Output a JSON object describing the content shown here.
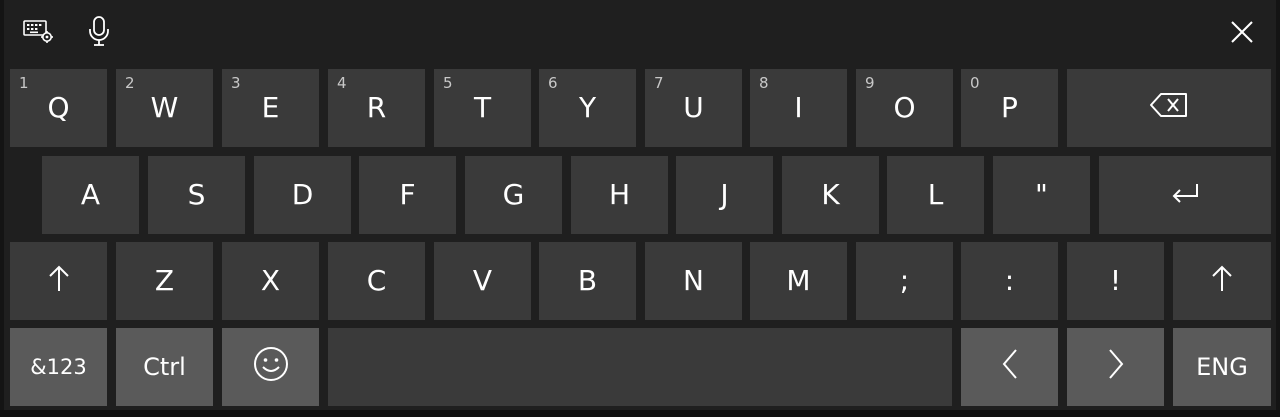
{
  "toolbar": {
    "settings_icon": "keyboard-settings-icon",
    "mic_icon": "microphone-icon",
    "close_icon": "close-icon"
  },
  "row1": [
    {
      "num": "1",
      "label": "Q"
    },
    {
      "num": "2",
      "label": "W"
    },
    {
      "num": "3",
      "label": "E"
    },
    {
      "num": "4",
      "label": "R"
    },
    {
      "num": "5",
      "label": "T"
    },
    {
      "num": "6",
      "label": "Y"
    },
    {
      "num": "7",
      "label": "U"
    },
    {
      "num": "8",
      "label": "I"
    },
    {
      "num": "9",
      "label": "O"
    },
    {
      "num": "0",
      "label": "P"
    }
  ],
  "row2": [
    "A",
    "S",
    "D",
    "F",
    "G",
    "H",
    "J",
    "K",
    "L",
    "\""
  ],
  "row3": [
    "Z",
    "X",
    "C",
    "V",
    "B",
    "N",
    "M",
    ";",
    ":",
    "!"
  ],
  "keys": {
    "backspace_icon": "backspace-icon",
    "enter_icon": "enter-icon",
    "shift_icon": "shift-arrow-icon",
    "symbols_label": "&123",
    "ctrl_label": "Ctrl",
    "emoji_icon": "emoji-smiley-icon",
    "left_label": "<",
    "right_label": ">",
    "lang_label": "ENG"
  },
  "colors": {
    "key": "#3a3a3a",
    "function_key": "#2b2b2b",
    "highlight_key": "#5a5a5a",
    "background": "#1f1f1f"
  }
}
